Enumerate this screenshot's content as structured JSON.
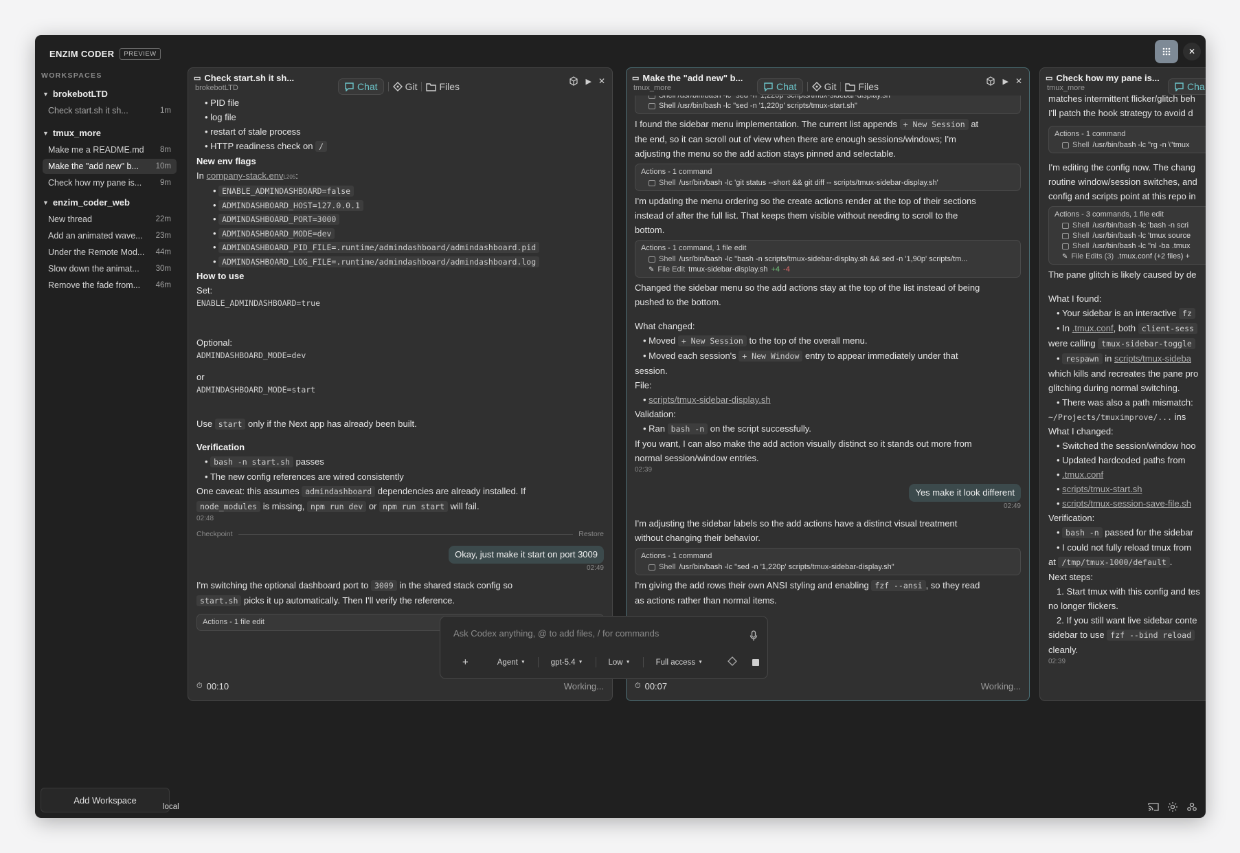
{
  "app": {
    "name": "ENZIM CODER",
    "badge": "PREVIEW"
  },
  "sidebar": {
    "header": "WORKSPACES",
    "groups": [
      {
        "name": "brokebotLTD",
        "threads": [
          {
            "title": "Check start.sh it sh...",
            "age": "1m"
          }
        ]
      },
      {
        "name": "tmux_more",
        "threads": [
          {
            "title": "Make me a README.md",
            "age": "8m"
          },
          {
            "title": "Make the \"add new\" b...",
            "age": "10m"
          },
          {
            "title": "Check how my pane is...",
            "age": "9m"
          }
        ]
      },
      {
        "name": "enzim_coder_web",
        "threads": [
          {
            "title": "New thread",
            "age": "22m"
          },
          {
            "title": "Add an animated wave...",
            "age": "23m"
          },
          {
            "title": "Under the Remote Mod...",
            "age": "44m"
          },
          {
            "title": "Slow down the animat...",
            "age": "30m"
          },
          {
            "title": "Remove the fade from...",
            "age": "46m"
          }
        ]
      }
    ],
    "add_workspace": "Add Workspace"
  },
  "tabs": {
    "chat": "Chat",
    "git": "Git",
    "files": "Files"
  },
  "panel1": {
    "title": "Check start.sh it sh...",
    "workspace": "brokebotLTD",
    "b1": "PID file",
    "b2": "log file",
    "b3": "restart of stale process",
    "b4": "HTTP readiness check on",
    "b4c": "/",
    "h_env": "New env flags",
    "in_lbl": "In",
    "env_link": "company-stack.env",
    "env_line": "L205",
    "env": [
      "ENABLE_ADMINDASHBOARD=false",
      "ADMINDASHBOARD_HOST=127.0.0.1",
      "ADMINDASHBOARD_PORT=3000",
      "ADMINDASHBOARD_MODE=dev",
      "ADMINDASHBOARD_PID_FILE=.runtime/admindashboard/admindashboard.pid",
      "ADMINDASHBOARD_LOG_FILE=.runtime/admindashboard/admindashboard.log"
    ],
    "h_use": "How to use",
    "set": "Set:",
    "set_code": "ENABLE_ADMINDASHBOARD=true",
    "optional": "Optional:",
    "opt_code": "ADMINDASHBOARD_MODE=dev",
    "or": "or",
    "or_code": "ADMINDASHBOARD_MODE=start",
    "use1": "Use",
    "use_code": "start",
    "use2": "only if the Next app has already been built.",
    "h_ver": "Verification",
    "v1_code": "bash -n start.sh",
    "v1": "passes",
    "v2": "The new config references are wired consistently",
    "cav1": "One caveat: this assumes",
    "cav_code1": "admindashboard",
    "cav2": "dependencies are already installed. If",
    "cav_code2": "node_modules",
    "cav3": "is missing,",
    "cav_code3": "npm run dev",
    "cav4": "or",
    "cav_code4": "npm run start",
    "cav5": "will fail.",
    "ts1": "02:48",
    "checkpoint": "Checkpoint",
    "restore": "Restore",
    "user_msg": "Okay, just make it start on port 3009",
    "ts2": "02:49",
    "sw1": "I'm switching the optional dashboard port to",
    "sw_code": "3009",
    "sw2": "in the shared stack config so",
    "sw_code2": "start.sh",
    "sw3": "picks it up automatically. Then I'll verify the reference.",
    "actions": "Actions - 1 file edit",
    "timer": "00:10",
    "working": "Working..."
  },
  "panel2": {
    "title": "Make the \"add new\" b...",
    "workspace": "tmux_more",
    "top_shell1": "Shell  /usr/bin/bash -lc \"sed -n '1,220p' scripts/tmux-sidebar-display.sh\"",
    "top_shell2": "Shell  /usr/bin/bash -lc \"sed -n '1,220p' scripts/tmux-start.sh\"",
    "p1a": "I found the sidebar menu implementation. The current list appends",
    "p1c": "+ New Session",
    "p1b": "at",
    "p1d": "the end, so it can scroll out of view when there are enough sessions/windows; I'm",
    "p1e": "adjusting the menu so the add action stays pinned and selectable.",
    "a1": "Actions - 1 command",
    "a1s": "Shell",
    "a1c": "/usr/bin/bash -lc 'git status --short && git diff -- scripts/tmux-sidebar-display.sh'",
    "p2a": "I'm updating the menu ordering so the create actions render at the top of their sections",
    "p2b": "instead of after the full list. That keeps them visible without needing to scroll to the",
    "p2c": "bottom.",
    "a2": "Actions - 1 command, 1 file edit",
    "a2s": "Shell",
    "a2c": "/usr/bin/bash -lc \"bash -n scripts/tmux-sidebar-display.sh && sed -n '1,90p' scripts/tm...",
    "a2f": "File Edit",
    "a2fn": "tmux-sidebar-display.sh",
    "a2plus": "+4",
    "a2minus": "-4",
    "p3a": "Changed the sidebar menu so the add actions stay at the top of the list instead of being",
    "p3b": "pushed to the bottom.",
    "wc": "What changed:",
    "m1a": "Moved",
    "m1c": "+ New Session",
    "m1b": "to the top of the overall menu.",
    "m2a": "Moved each session's",
    "m2c": "+ New Window",
    "m2b": "entry to appear immediately under that",
    "m2d": "session.",
    "file": "File:",
    "file_link": "scripts/tmux-sidebar-display.sh",
    "val": "Validation:",
    "ran": "Ran",
    "ran_code": "bash -n",
    "ran2": "on the script successfully.",
    "ifa": "If you want, I can also make the add action visually distinct so it stands out more from",
    "ifb": "normal session/window entries.",
    "ts1": "02:39",
    "user_msg": "Yes make it look different",
    "ts2": "02:49",
    "adj1": "I'm adjusting the sidebar labels so the add actions have a distinct visual treatment",
    "adj2": "without changing their behavior.",
    "a3": "Actions - 1 command",
    "a3s": "Shell",
    "a3c": "/usr/bin/bash -lc \"sed -n '1,220p' scripts/tmux-sidebar-display.sh\"",
    "g1": "I'm giving the add rows their own ANSI styling and enabling",
    "g_code": "fzf --ansi",
    "g2": ", so they read",
    "g3": "as actions rather than normal items.",
    "timer": "00:07",
    "working": "Working..."
  },
  "panel3": {
    "title": "Check how my pane is...",
    "workspace": "tmux_more",
    "tab_partial": "Cha",
    "l1": "matches intermittent flicker/glitch beh",
    "l2": "I'll patch the hook strategy to avoid d",
    "a1": "Actions - 1 command",
    "a1s": "Shell",
    "a1c": "/usr/bin/bash -lc \"rg -n \\\"tmux",
    "l3": "I'm editing the config now. The chang",
    "l4": "routine window/session switches, and",
    "l5": "config and scripts point at this repo in",
    "a2": "Actions - 3 commands, 1 file edit",
    "a2r1": "/usr/bin/bash -lc 'bash -n scri",
    "a2r2": "/usr/bin/bash -lc 'tmux source",
    "a2r3": "/usr/bin/bash -lc \"nl -ba .tmux",
    "a2f": "File Edits (3)",
    "a2fv": ".tmux.conf (+2 files)  +",
    "l6": "The pane glitch is likely caused by de",
    "wf": "What I found:",
    "f1": "Your sidebar is an interactive",
    "f1c": "fz",
    "f2a": "In",
    "f2l": ".tmux.conf",
    "f2b": ", both",
    "f2c": "client-sess",
    "f2d": "were calling",
    "f2e": "tmux-sidebar-toggle",
    "f3c": "respawn",
    "f3a": "in",
    "f3l": "scripts/tmux-sideba",
    "f3b": "which kills and recreates the pane pro",
    "f3d": "glitching during normal switching.",
    "f4": "There was also a path mismatch:",
    "f4c": "~/Projects/tmuximprove/...",
    "f4b": "ins",
    "wc": "What I changed:",
    "c1": "Switched the session/window hoo",
    "c2": "Updated hardcoded paths from",
    "c3": ".tmux.conf",
    "c4": "scripts/tmux-start.sh",
    "c5": "scripts/tmux-session-save-file.sh",
    "ver": "Verification:",
    "v1c": "bash -n",
    "v1": "passed for the sidebar",
    "v2": "I could not fully reload tmux from",
    "v3a": "at",
    "v3c": "/tmp/tmux-1000/default",
    "v3b": ".",
    "ns": "Next steps:",
    "n1": "1. Start tmux with this config and tes",
    "n1b": "no longer flickers.",
    "n2": "2. If you still want live sidebar conte",
    "n2a": "sidebar to use",
    "n2c": "fzf --bind reload",
    "n2b": "cleanly.",
    "ts": "02:39"
  },
  "composer": {
    "placeholder": "Ask Codex anything, @ to add files, / for commands",
    "plus": "+",
    "agent": "Agent",
    "model": "gpt-5.4",
    "effort": "Low",
    "access": "Full access"
  },
  "statusbar": {
    "location": "local"
  }
}
